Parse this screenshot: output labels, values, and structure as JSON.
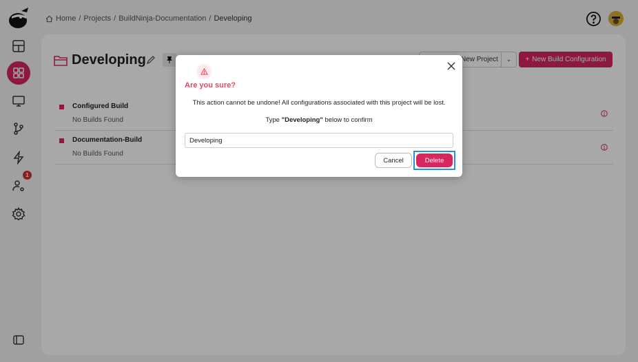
{
  "breadcrumb": {
    "home": "Home",
    "sep": "/",
    "projects": "Projects",
    "parent": "BuildNinja-Documentation",
    "current": "Developing"
  },
  "sidebar": {
    "items": [
      {
        "icon": "dashboard-icon"
      },
      {
        "icon": "projects-grid-icon",
        "active": true
      },
      {
        "icon": "monitor-icon"
      },
      {
        "icon": "git-branch-icon"
      },
      {
        "icon": "lightning-icon"
      },
      {
        "icon": "user-settings-icon",
        "badge": "1"
      },
      {
        "icon": "gear-icon"
      }
    ]
  },
  "page": {
    "title": "Developing",
    "new_project_label": "New Project",
    "new_build_config_label": "New Build Configuration"
  },
  "builds": [
    {
      "name": "Configured Build",
      "status": "No Builds Found"
    },
    {
      "name": "Documentation-Build",
      "status": "No Builds Found"
    }
  ],
  "modal": {
    "title": "Are you sure?",
    "message": "This action cannot be undone! All configurations associated with this project will be lost.",
    "hint_prefix": "Type ",
    "hint_name": "\"Developing\"",
    "hint_suffix": " below to confirm",
    "input_value": "Developing",
    "cancel_label": "Cancel",
    "delete_label": "Delete"
  },
  "colors": {
    "accent": "#d6285e",
    "warning_text": "#e0475f",
    "focus_ring": "#2a8de0"
  }
}
